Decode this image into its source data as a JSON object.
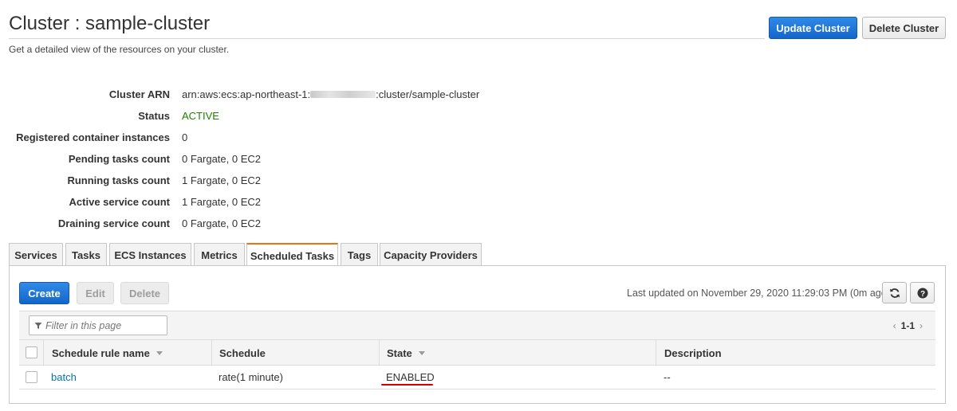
{
  "header": {
    "title": "Cluster : sample-cluster",
    "subtitle": "Get a detailed view of the resources on your cluster.",
    "update_button": "Update Cluster",
    "delete_button": "Delete Cluster"
  },
  "details": [
    {
      "label": "Cluster ARN",
      "value_prefix": "arn:aws:ecs:ap-northeast-1:",
      "value_suffix": ":cluster/sample-cluster"
    },
    {
      "label": "Status",
      "value": "ACTIVE"
    },
    {
      "label": "Registered container instances",
      "value": "0"
    },
    {
      "label": "Pending tasks count",
      "value": "0 Fargate, 0 EC2"
    },
    {
      "label": "Running tasks count",
      "value": "1 Fargate, 0 EC2"
    },
    {
      "label": "Active service count",
      "value": "1 Fargate, 0 EC2"
    },
    {
      "label": "Draining service count",
      "value": "0 Fargate, 0 EC2"
    }
  ],
  "tabs": [
    "Services",
    "Tasks",
    "ECS Instances",
    "Metrics",
    "Scheduled Tasks",
    "Tags",
    "Capacity Providers"
  ],
  "active_tab": "Scheduled Tasks",
  "toolbar": {
    "create": "Create",
    "edit": "Edit",
    "delete": "Delete",
    "last_updated": "Last updated on November 29, 2020 11:29:03 PM (0m ago)",
    "refresh_icon": "refresh-icon",
    "help_icon": "help-icon"
  },
  "table": {
    "filter_placeholder": "Filter in this page",
    "pagination": "1-1",
    "columns": [
      "Schedule rule name",
      "Schedule",
      "State",
      "Description"
    ],
    "rows": [
      {
        "name": "batch",
        "schedule": "rate(1 minute)",
        "state": "ENABLED",
        "description": "--"
      }
    ]
  },
  "colors": {
    "primary": "#1466c9",
    "status_active": "#1d8102",
    "link": "#0073bb",
    "tab_accent": "#ec7211",
    "highlight_underline": "#d40000"
  }
}
